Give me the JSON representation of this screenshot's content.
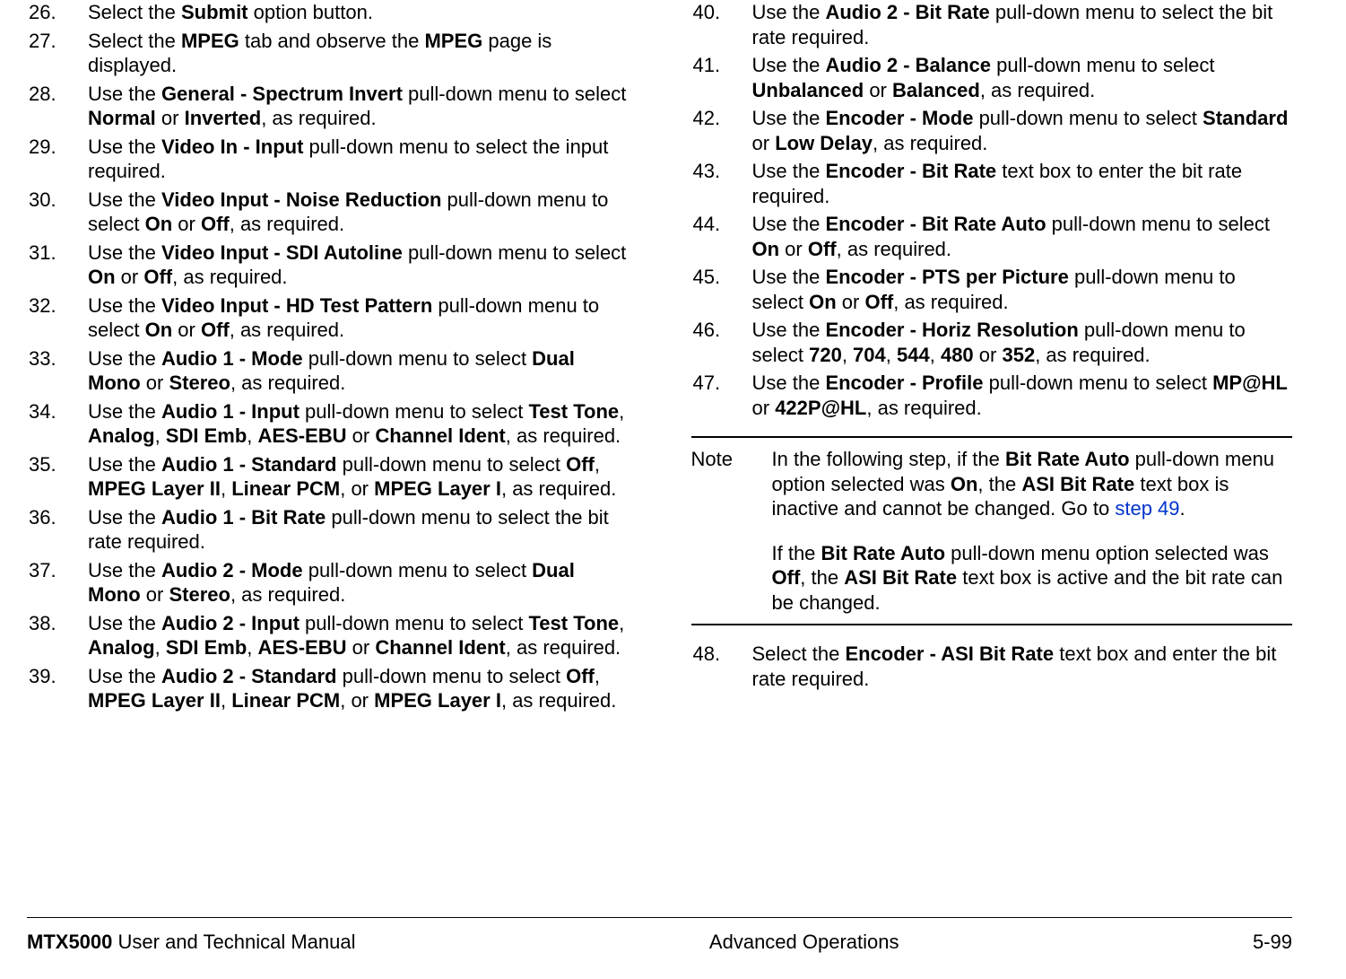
{
  "left_items": [
    {
      "num": "26.",
      "html": "Select the <b>Submit</b> option button."
    },
    {
      "num": "27.",
      "html": "Select the <b>MPEG</b> tab and observe the <b>MPEG</b> page is displayed."
    },
    {
      "num": "28.",
      "html": "Use the <b>General - Spectrum Invert</b> pull-down menu to select <b>Normal</b> or <b>Inverted</b>, as required."
    },
    {
      "num": "29.",
      "html": "Use the <b>Video In - Input</b> pull-down menu to select the input required."
    },
    {
      "num": "30.",
      "html": "Use the <b>Video Input - Noise Reduction</b> pull-down menu to select <b>On</b> or <b>Off</b>, as required."
    },
    {
      "num": "31.",
      "html": "Use the <b>Video Input - SDI Autoline</b> pull-down menu to select <b>On</b> or <b>Off</b>, as required."
    },
    {
      "num": "32.",
      "html": "Use the <b>Video Input - HD Test Pattern</b> pull-down menu to select <b>On</b> or <b>Off</b>, as required."
    },
    {
      "num": "33.",
      "html": "Use the <b>Audio 1 - Mode</b> pull-down menu to select <b>Dual Mono</b> or <b>Stereo</b>, as required."
    },
    {
      "num": "34.",
      "html": "Use the <b>Audio 1 - Input</b> pull-down menu to select <b>Test Tone</b>, <b>Analog</b>, <b>SDI Emb</b>, <b>AES-EBU</b> or <b>Channel Ident</b>, as required."
    },
    {
      "num": "35.",
      "html": "Use the <b>Audio 1 - Standard</b> pull-down menu to select <b>Off</b>, <b>MPEG Layer II</b>, <b>Linear PCM</b>, or <b>MPEG Layer I</b>, as required."
    },
    {
      "num": "36.",
      "html": "Use the <b>Audio 1 - Bit Rate</b> pull-down menu to select the bit rate required."
    },
    {
      "num": "37.",
      "html": "Use the <b>Audio 2 - Mode</b> pull-down menu to select <b>Dual Mono</b> or <b>Stereo</b>, as required."
    },
    {
      "num": "38.",
      "html": "Use the <b>Audio 2 - Input</b> pull-down menu to select <b>Test Tone</b>, <b>Analog</b>, <b>SDI Emb</b>, <b>AES-EBU</b> or <b>Channel Ident</b>, as required."
    },
    {
      "num": "39.",
      "html": "Use the <b>Audio 2 - Standard</b> pull-down menu to select <b>Off</b>, <b>MPEG Layer II</b>, <b>Linear PCM</b>, or <b>MPEG Layer I</b>, as required."
    }
  ],
  "right_items_top": [
    {
      "num": "40.",
      "html": "Use the <b>Audio 2 - Bit Rate</b> pull-down menu to select the bit rate required."
    },
    {
      "num": "41.",
      "html": "Use the <b>Audio 2 - Balance</b> pull-down menu to select <b>Unbalanced</b> or <b>Balanced</b>, as required."
    },
    {
      "num": "42.",
      "html": "Use the <b>Encoder - Mode</b> pull-down menu to select <b>Standard</b> or <b>Low Delay</b>, as required."
    },
    {
      "num": "43.",
      "html": "Use the <b>Encoder - Bit Rate</b> text box to enter the bit rate required."
    },
    {
      "num": "44.",
      "html": "Use the <b>Encoder - Bit Rate Auto</b> pull-down menu to select <b>On</b> or <b>Off</b>, as required."
    },
    {
      "num": "45.",
      "html": "Use the <b>Encoder - PTS per Picture</b> pull-down menu to select <b>On</b> or <b>Off</b>, as required."
    },
    {
      "num": "46.",
      "html": "Use the <b>Encoder - Horiz Resolution</b> pull-down menu to select <b>720</b>, <b>704</b>, <b>544</b>, <b>480</b> or <b>352</b>, as required."
    },
    {
      "num": "47.",
      "html": "Use the <b>Encoder - Profile</b> pull-down menu to select <b>MP@HL</b> or <b>422P@HL</b>, as required."
    }
  ],
  "note": {
    "label": "Note",
    "para1_html": "In the following step, if the <b>Bit Rate Auto</b> pull-down menu option selected was <b>On</b>, the <b>ASI Bit Rate</b> text box is inactive and cannot be changed.  Go to <span class=\"link\">step 49</span>.",
    "para2_html": "If the <b>Bit Rate Auto</b> pull-down menu option selected was <b>Off</b>, the <b>ASI Bit Rate</b> text box is active and the bit rate can be changed."
  },
  "right_items_bottom": [
    {
      "num": "48.",
      "html": "Select the <b>Encoder - ASI Bit Rate</b> text box and enter the bit rate required."
    }
  ],
  "footer": {
    "left_bold": "MTX5000",
    "left_rest": " User and Technical Manual",
    "center": "Advanced Operations",
    "right": "5-99"
  }
}
